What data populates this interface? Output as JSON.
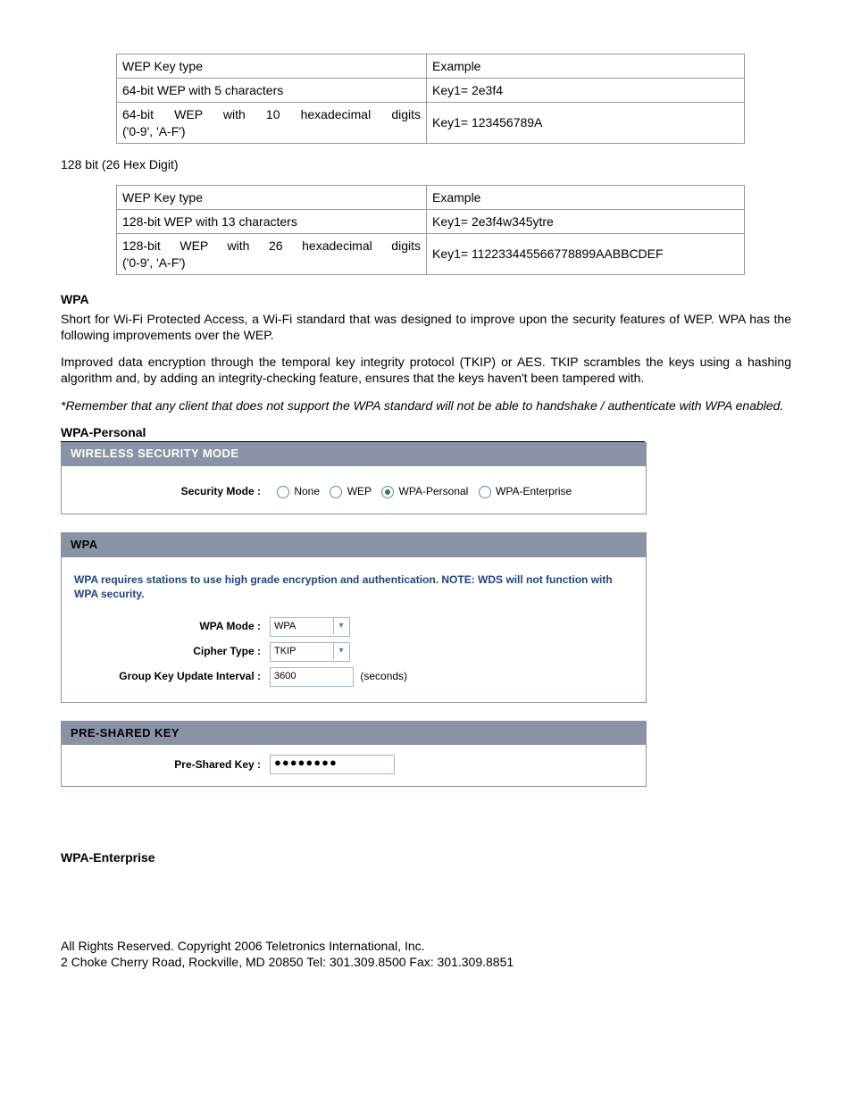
{
  "tables": {
    "t64": {
      "r1c1": "WEP Key type",
      "r1c2": "Example",
      "r2c1": "64-bit WEP with 5 characters",
      "r2c2": "Key1= 2e3f4",
      "r3c1a": "64-bit WEP with 10 hexadecimal digits",
      "r3c1b": "('0-9', 'A-F')",
      "r3c2": "Key1= 123456789A"
    },
    "note128": "128 bit (26 Hex Digit)",
    "t128": {
      "r1c1": "WEP Key type",
      "r1c2": "Example",
      "r2c1": "128-bit WEP with 13 characters",
      "r2c2": "Key1= 2e3f4w345ytre",
      "r3c1a": "128-bit WEP with 26 hexadecimal digits",
      "r3c1b": "('0-9', 'A-F')",
      "r3c2": "Key1= 112233445566778899AABBCDEF"
    }
  },
  "wpa": {
    "heading": "WPA",
    "p1": "Short for Wi-Fi Protected Access, a Wi-Fi standard that was designed to improve upon the security features of WEP. WPA has the following improvements over the WEP.",
    "p2": "Improved data encryption through the temporal key integrity protocol (TKIP) or AES. TKIP scrambles the keys using a hashing algorithm and, by adding an integrity-checking feature, ensures that the keys haven't been tampered with.",
    "p3": "*Remember that any client that does not support the WPA standard will not be able to handshake / authenticate with WPA enabled."
  },
  "personal": {
    "heading": "WPA-Personal",
    "panel1title": "WIRELESS SECURITY MODE",
    "secmode_label": "Security Mode :",
    "opts": {
      "none": "None",
      "wep": "WEP",
      "wpap": "WPA-Personal",
      "wpae": "WPA-Enterprise"
    }
  },
  "wpapanel": {
    "title": "WPA",
    "note": "WPA requires stations to use high grade encryption and authentication. NOTE: WDS will not function with WPA security.",
    "rows": {
      "mode_label": "WPA Mode :",
      "mode_value": "WPA",
      "cipher_label": "Cipher Type :",
      "cipher_value": "TKIP",
      "gkui_label": "Group Key Update Interval :",
      "gkui_value": "3600",
      "gkui_unit": "(seconds)"
    }
  },
  "psk": {
    "title": "PRE-SHARED KEY",
    "label": "Pre-Shared Key :",
    "value": "●●●●●●●●"
  },
  "enterprise": {
    "heading": "WPA-Enterprise"
  },
  "footer": {
    "l1": "All Rights Reserved. Copyright 2006 Teletronics International, Inc.",
    "l2": "2 Choke Cherry Road, Rockville, MD 20850    Tel: 301.309.8500 Fax: 301.309.8851"
  }
}
